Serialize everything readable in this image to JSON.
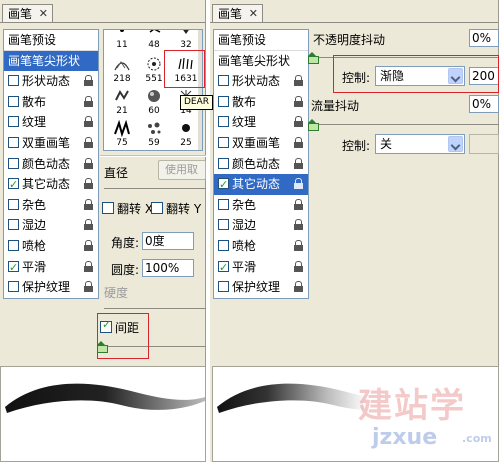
{
  "left_panel": {
    "tab_title": "画笔",
    "tab_close": "✕",
    "list": {
      "header": "画笔预设",
      "items": [
        {
          "label": "画笔笔尖形状",
          "selected": true,
          "checkbox": false,
          "checked": false,
          "lock": false
        },
        {
          "label": "形状动态",
          "checkbox": true,
          "checked": false,
          "lock": true
        },
        {
          "label": "散布",
          "checkbox": true,
          "checked": false,
          "lock": true
        },
        {
          "label": "纹理",
          "checkbox": true,
          "checked": false,
          "lock": true
        },
        {
          "label": "双重画笔",
          "checkbox": true,
          "checked": false,
          "lock": true
        },
        {
          "label": "颜色动态",
          "checkbox": true,
          "checked": false,
          "lock": true
        },
        {
          "label": "其它动态",
          "checkbox": true,
          "checked": true,
          "lock": true
        },
        {
          "label": "杂色",
          "checkbox": true,
          "checked": false,
          "lock": true
        },
        {
          "label": "湿边",
          "checkbox": true,
          "checked": false,
          "lock": true
        },
        {
          "label": "喷枪",
          "checkbox": true,
          "checked": false,
          "lock": true
        },
        {
          "label": "平滑",
          "checkbox": true,
          "checked": true,
          "lock": true
        },
        {
          "label": "保护纹理",
          "checkbox": true,
          "checked": false,
          "lock": true
        }
      ]
    },
    "brush_sizes": [
      "11",
      "48",
      "32",
      "218",
      "551",
      "1631",
      "21",
      "60",
      "14",
      "75",
      "59",
      "25"
    ],
    "tooltip": "DEAR",
    "diameter_label": "直径",
    "use_sample_button": "使用取样大小",
    "flip_x": "翻转 X",
    "flip_y": "翻转 Y",
    "angle_label": "角度:",
    "angle_value": "0度",
    "roundness_label": "圆度:",
    "roundness_value": "100%",
    "hardness_label": "硬度",
    "spacing_label": "间距",
    "spacing_checked": true
  },
  "right_panel": {
    "tab_title": "画笔",
    "tab_close": "✕",
    "list": {
      "header": "画笔预设",
      "items": [
        {
          "label": "画笔笔尖形状",
          "selected": false,
          "checkbox": false,
          "checked": false,
          "lock": false
        },
        {
          "label": "形状动态",
          "checkbox": true,
          "checked": false,
          "lock": true
        },
        {
          "label": "散布",
          "checkbox": true,
          "checked": false,
          "lock": true
        },
        {
          "label": "纹理",
          "checkbox": true,
          "checked": false,
          "lock": true
        },
        {
          "label": "双重画笔",
          "checkbox": true,
          "checked": false,
          "lock": true
        },
        {
          "label": "颜色动态",
          "checkbox": true,
          "checked": false,
          "lock": true
        },
        {
          "label": "其它动态",
          "checkbox": true,
          "checked": true,
          "selected": true,
          "lock": true
        },
        {
          "label": "杂色",
          "checkbox": true,
          "checked": false,
          "lock": true
        },
        {
          "label": "湿边",
          "checkbox": true,
          "checked": false,
          "lock": true
        },
        {
          "label": "喷枪",
          "checkbox": true,
          "checked": false,
          "lock": true
        },
        {
          "label": "平滑",
          "checkbox": true,
          "checked": true,
          "lock": true
        },
        {
          "label": "保护纹理",
          "checkbox": true,
          "checked": false,
          "lock": true
        }
      ]
    },
    "opacity_jitter_label": "不透明度抖动",
    "opacity_jitter_value": "0%",
    "control1_label": "控制:",
    "control1_value": "渐隐",
    "control1_steps": "200",
    "flow_jitter_label": "流量抖动",
    "flow_jitter_value": "0%",
    "control2_label": "控制:",
    "control2_value": "关"
  },
  "watermark": {
    "text_cn": "建站学",
    "text_url": "jzxue",
    "text_com": ".com"
  },
  "colors": {
    "panel_bg": "#ece9d8",
    "selection": "#316ac5",
    "highlight_box": "#d9242b"
  }
}
